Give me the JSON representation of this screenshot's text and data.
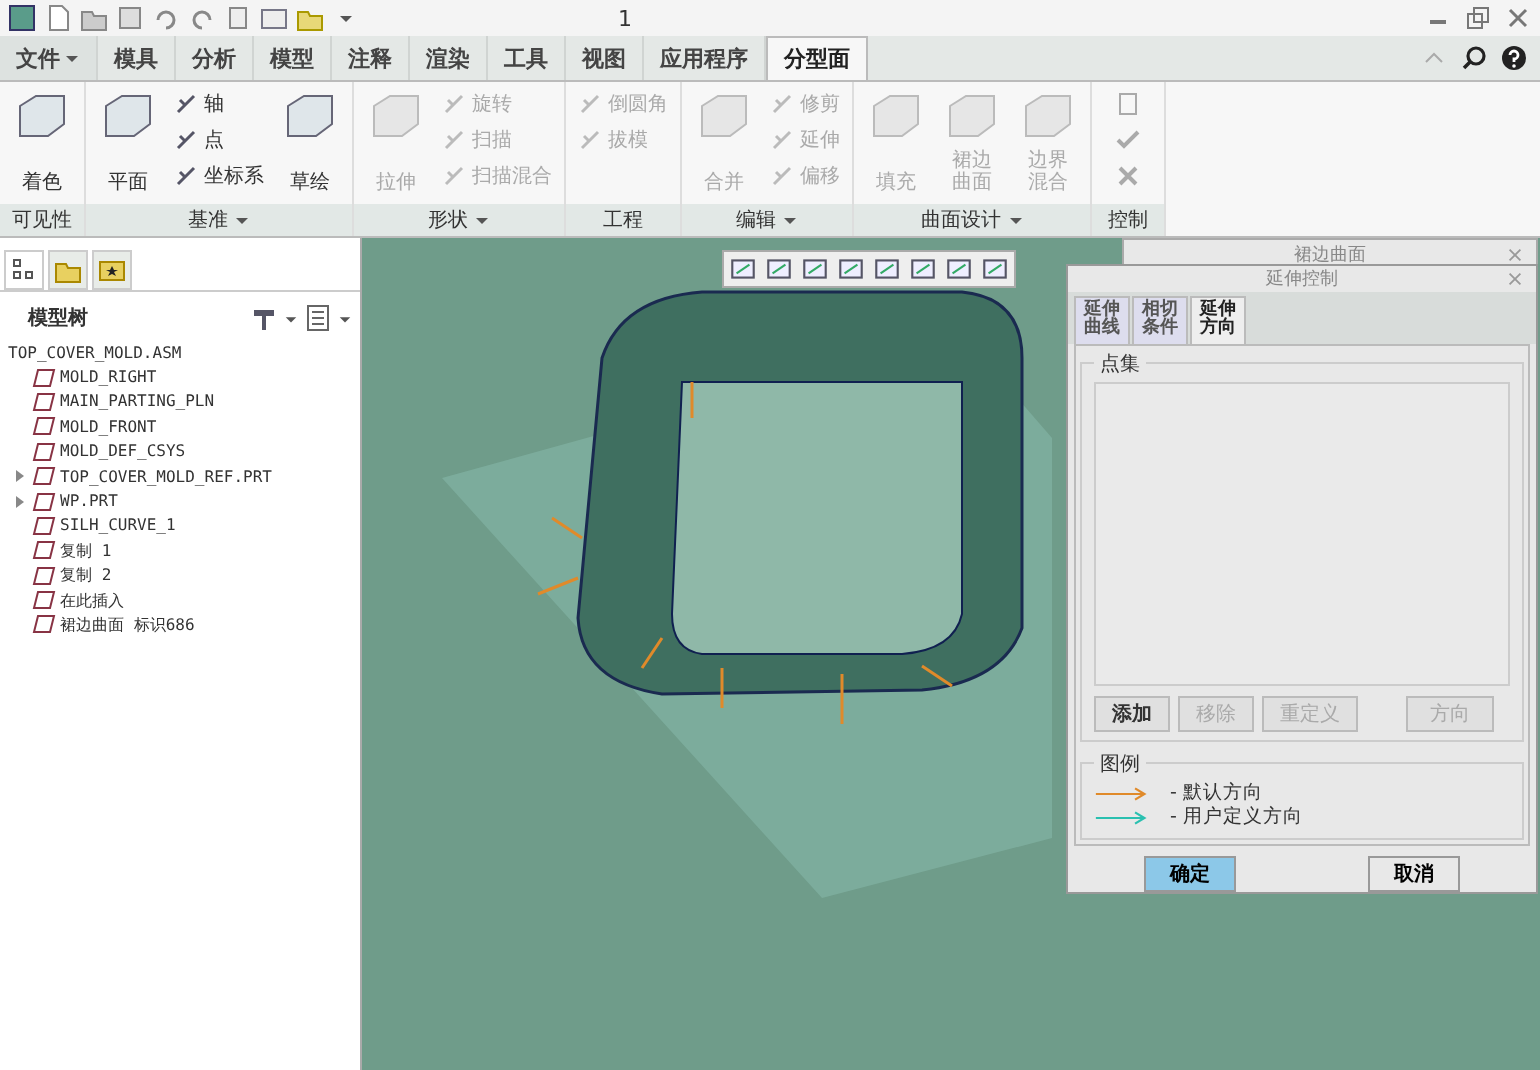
{
  "window": {
    "title": "1"
  },
  "ribbon_tabs": [
    {
      "label": "文件",
      "dropdown": true,
      "selected": false
    },
    {
      "label": "模具",
      "dropdown": false,
      "selected": false
    },
    {
      "label": "分析",
      "dropdown": false,
      "selected": false
    },
    {
      "label": "模型",
      "dropdown": false,
      "selected": false
    },
    {
      "label": "注释",
      "dropdown": false,
      "selected": false
    },
    {
      "label": "渲染",
      "dropdown": false,
      "selected": false
    },
    {
      "label": "工具",
      "dropdown": false,
      "selected": false
    },
    {
      "label": "视图",
      "dropdown": false,
      "selected": false
    },
    {
      "label": "应用程序",
      "dropdown": false,
      "selected": false
    },
    {
      "label": "分型面",
      "dropdown": false,
      "selected": true
    }
  ],
  "ribbon_groups": [
    {
      "label": "可见性",
      "dropdown": false,
      "items": [
        {
          "kind": "big",
          "label": "着色",
          "disabled": false
        }
      ]
    },
    {
      "label": "基准",
      "dropdown": true,
      "items": [
        {
          "kind": "big",
          "label": "平面",
          "disabled": false
        },
        {
          "kind": "small",
          "label": "轴",
          "disabled": false
        },
        {
          "kind": "small",
          "label": "点",
          "disabled": false
        },
        {
          "kind": "small",
          "label": "坐标系",
          "disabled": false
        },
        {
          "kind": "big",
          "label": "草绘",
          "disabled": false
        }
      ]
    },
    {
      "label": "形状",
      "dropdown": true,
      "items": [
        {
          "kind": "big",
          "label": "拉伸",
          "disabled": true
        },
        {
          "kind": "small",
          "label": "旋转",
          "disabled": true
        },
        {
          "kind": "small",
          "label": "扫描",
          "disabled": true
        },
        {
          "kind": "small",
          "label": "扫描混合",
          "disabled": true
        }
      ]
    },
    {
      "label": "工程",
      "dropdown": false,
      "items": [
        {
          "kind": "small",
          "label": "倒圆角",
          "disabled": true
        },
        {
          "kind": "small",
          "label": "拔模",
          "disabled": true
        }
      ]
    },
    {
      "label": "编辑",
      "dropdown": true,
      "items": [
        {
          "kind": "big",
          "label": "合并",
          "disabled": true
        },
        {
          "kind": "small",
          "label": "修剪",
          "disabled": true
        },
        {
          "kind": "small",
          "label": "延伸",
          "disabled": true
        },
        {
          "kind": "small",
          "label": "偏移",
          "disabled": true
        }
      ]
    },
    {
      "label": "曲面设计",
      "dropdown": true,
      "items": [
        {
          "kind": "big",
          "label": "填充",
          "disabled": true
        },
        {
          "kind": "big",
          "label": "裙边曲面",
          "disabled": true
        },
        {
          "kind": "big",
          "label": "边界混合",
          "disabled": true
        }
      ]
    },
    {
      "label": "控制",
      "dropdown": false,
      "items": [
        {
          "kind": "icon",
          "disabled": true
        }
      ]
    }
  ],
  "model_tree": {
    "title": "模型树",
    "items": [
      {
        "label": "TOP_COVER_MOLD.ASM",
        "children": [
          {
            "label": "MOLD_RIGHT"
          },
          {
            "label": "MAIN_PARTING_PLN"
          },
          {
            "label": "MOLD_FRONT"
          },
          {
            "label": "MOLD_DEF_CSYS"
          },
          {
            "label": "TOP_COVER_MOLD_REF.PRT",
            "expanded": false
          },
          {
            "label": "WP.PRT",
            "expanded": false
          },
          {
            "label": "SILH_CURVE_1"
          },
          {
            "label": "复制 1"
          },
          {
            "label": "复制 2"
          },
          {
            "label": "在此插入"
          },
          {
            "label": "裙边曲面 标识686"
          }
        ]
      }
    ]
  },
  "back_dialog": {
    "title": "裙边曲面"
  },
  "dialog": {
    "title": "延伸控制",
    "tabs": [
      {
        "label": "延伸曲线",
        "selected": false
      },
      {
        "label": "相切条件",
        "selected": false
      },
      {
        "label": "延伸方向",
        "selected": true
      }
    ],
    "point_set": {
      "title": "点集"
    },
    "buttons": [
      {
        "label": "添加",
        "disabled": false
      },
      {
        "label": "移除",
        "disabled": true
      },
      {
        "label": "重定义",
        "disabled": true
      },
      {
        "label": "方向",
        "disabled": true
      }
    ],
    "legend": {
      "title": "图例",
      "entries": [
        {
          "label": "- 默认方向",
          "color": "#e08a2a"
        },
        {
          "label": "- 用户定义方向",
          "color": "#2ac0b0"
        }
      ]
    },
    "footer_buttons": [
      {
        "label": "确定",
        "kind": "primary"
      },
      {
        "label": "取消",
        "kind": "normal"
      }
    ]
  }
}
